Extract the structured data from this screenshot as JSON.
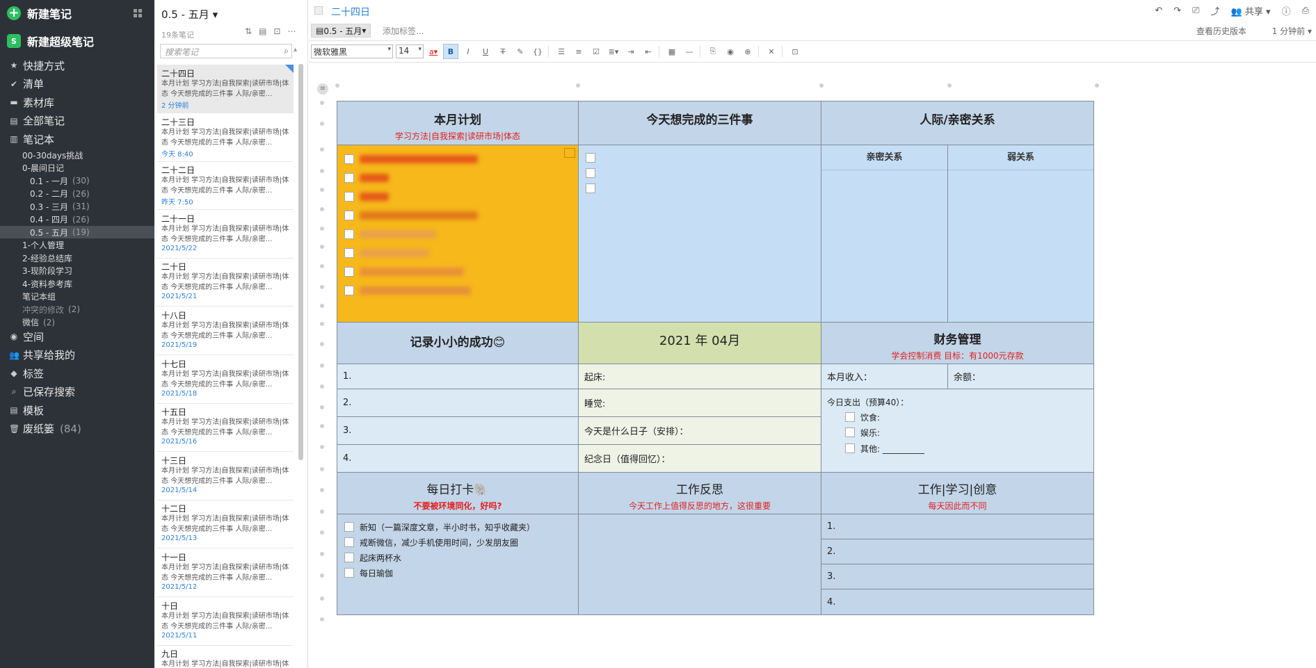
{
  "sidebar": {
    "new_note": "新建笔记",
    "new_super_note": "新建超级笔记",
    "super_badge": "S",
    "nav": [
      {
        "label": "快捷方式",
        "icon": "star-icon"
      },
      {
        "label": "清单",
        "icon": "check-circle-icon"
      },
      {
        "label": "素材库",
        "icon": "library-icon"
      },
      {
        "label": "全部笔记",
        "icon": "notes-icon"
      },
      {
        "label": "笔记本",
        "icon": "notebook-icon"
      }
    ],
    "notebooks": [
      {
        "label": "00-30days挑战",
        "count": "",
        "indent": 1
      },
      {
        "label": "0-晨间日记",
        "count": "",
        "indent": 1
      },
      {
        "label": "0.1 - 一月",
        "count": "(30)",
        "indent": 2
      },
      {
        "label": "0.2 - 二月",
        "count": "(26)",
        "indent": 2
      },
      {
        "label": "0.3 - 三月",
        "count": "(31)",
        "indent": 2
      },
      {
        "label": "0.4 - 四月",
        "count": "(26)",
        "indent": 2
      },
      {
        "label": "0.5 - 五月",
        "count": "(19)",
        "indent": 2
      },
      {
        "label": "1-个人管理",
        "count": "",
        "indent": 1
      },
      {
        "label": "2-经验总结库",
        "count": "",
        "indent": 1
      },
      {
        "label": "3-现阶段学习",
        "count": "",
        "indent": 1
      },
      {
        "label": "4-资料参考库",
        "count": "",
        "indent": 1
      },
      {
        "label": "笔记本组",
        "count": "",
        "indent": 1
      },
      {
        "label": "冲突的修改",
        "count": "(2)",
        "indent": 1
      },
      {
        "label": "微信",
        "count": "(2)",
        "indent": 1
      }
    ],
    "nav2": [
      {
        "label": "空间",
        "icon": "space-icon",
        "count": ""
      },
      {
        "label": "共享给我的",
        "icon": "shared-icon",
        "count": ""
      },
      {
        "label": "标签",
        "icon": "tag-icon",
        "count": ""
      },
      {
        "label": "已保存搜索",
        "icon": "search-icon",
        "count": ""
      },
      {
        "label": "模板",
        "icon": "template-icon",
        "count": ""
      },
      {
        "label": "废纸篓",
        "icon": "trash-icon",
        "count": "(84)"
      }
    ]
  },
  "list": {
    "title": "0.5 - 五月",
    "count": "19条笔记",
    "search_placeholder": "搜索笔记",
    "preview": "本月计划 学习方法|自我探索|读研市场|体态 今天想完成的三件事 人际/亲密...",
    "notes": [
      {
        "title": "二十四日",
        "date": "2 分钟前"
      },
      {
        "title": "二十三日",
        "date": "今天 8:40"
      },
      {
        "title": "二十二日",
        "date": "昨天 7:50"
      },
      {
        "title": "二十一日",
        "date": "2021/5/22"
      },
      {
        "title": "二十日",
        "date": "2021/5/21"
      },
      {
        "title": "十八日",
        "date": "2021/5/19"
      },
      {
        "title": "十七日",
        "date": "2021/5/18"
      },
      {
        "title": "十五日",
        "date": "2021/5/16"
      },
      {
        "title": "十三日",
        "date": "2021/5/14"
      },
      {
        "title": "十二日",
        "date": "2021/5/13"
      },
      {
        "title": "十一日",
        "date": "2021/5/12"
      },
      {
        "title": "十日",
        "date": "2021/5/11"
      },
      {
        "title": "九日",
        "date": ""
      }
    ]
  },
  "editor": {
    "title": "二十四日",
    "notebook": "0.5 - 五月",
    "add_tag": "添加标签...",
    "share": "共享",
    "history": "查看历史版本",
    "time_ago": "1 分钟前",
    "font": "微软雅黑",
    "size": "14"
  },
  "doc": {
    "plan": {
      "title": "本月计划",
      "sub": "学习方法|自我探索|读研市场|体态"
    },
    "three": {
      "title": "今天想完成的三件事"
    },
    "people": {
      "title": "人际/亲密关系",
      "close": "亲密关系",
      "weak": "弱关系"
    },
    "success": {
      "title": "记录小小的成功😊",
      "items": [
        "1.",
        "2.",
        "3.",
        "4."
      ]
    },
    "date": {
      "title": "2021 年 04月",
      "items": [
        "起床:",
        "睡觉:",
        "今天是什么日子（安排）：",
        "纪念日（值得回忆）："
      ]
    },
    "finance": {
      "title": "财务管理",
      "sub": "学会控制消费  目标：有1000元存款",
      "income": "本月收入：",
      "balance": "余额：",
      "spend": "今日支出（预算40）：",
      "items": [
        "饮食:",
        "娱乐:",
        "其他: __________"
      ]
    },
    "checkin": {
      "title": "每日打卡🐘",
      "sub": "不要被环境同化，好吗?",
      "items": [
        "新知（一篇深度文章，半小时书，知乎收藏夹）",
        "戒断微信，减少手机使用时间，少发朋友圈",
        "起床两杯水",
        "每日瑜伽"
      ]
    },
    "reflect": {
      "title": "工作反思",
      "sub": "今天工作上值得反思的地方，这很重要"
    },
    "work": {
      "title": "工作|学习|创意",
      "sub": "每天因此而不同",
      "items": [
        "1.",
        "2.",
        "3.",
        "4."
      ]
    }
  }
}
